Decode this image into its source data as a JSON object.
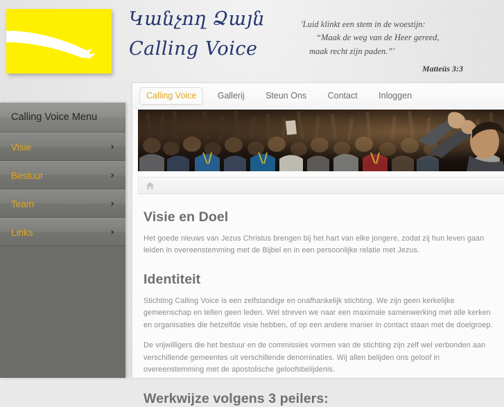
{
  "header": {
    "logo_alt": "Calling Voice logo",
    "brand_armenian": "Կանչող Ձայն",
    "brand_english": "Calling Voice",
    "verse_line1": "'Luid klinkt een stem in de woestijn:",
    "verse_line2": "“Maak de weg van de Heer gereed,",
    "verse_line3": "maak recht zijn paden.”'",
    "verse_ref": "Matteüs 3:3"
  },
  "sidebar": {
    "title": "Calling Voice Menu",
    "items": [
      {
        "label": "Visie",
        "chevron": "›"
      },
      {
        "label": "Bestuur",
        "chevron": "›"
      },
      {
        "label": "Team",
        "chevron": "›"
      },
      {
        "label": "Links",
        "chevron": "›"
      }
    ]
  },
  "nav": {
    "tabs": [
      {
        "label": "Calling Voice",
        "active": true
      },
      {
        "label": "Gallerij",
        "active": false
      },
      {
        "label": "Steun Ons",
        "active": false
      },
      {
        "label": "Contact",
        "active": false
      },
      {
        "label": "Inloggen",
        "active": false
      }
    ]
  },
  "breadcrumb": {
    "home_icon": "home-icon"
  },
  "main": {
    "heading1": "Visie en Doel",
    "paragraph1": "Het goede nieuws van Jezus Christus brengen bij het hart van elke jongere, zodat zij hun leven gaan leiden in overeenstemming met de Bijbel en in een persoonlijke relatie met Jezus.",
    "heading2": "Identiteit",
    "paragraph2": "Stichting Calling Voice is een zelfstandige en onafhankelijk stichting. We zijn geen kerkelijke gemeenschap en tellen geen leden. Wel streven we naar een maximale samenwerking met alle kerken en organisaties die hetzelfde visie hebben, of op een andere manier in contact staan met de doelgroep.",
    "paragraph3": "De vrijwilligers die het bestuur en de commissies vormen van de stichting zijn zelf wel verbonden aan verschillende gemeentes uit verschillende denominaties. Wij allen belijden ons geloof in overeenstemming met de apostolische geloofsbelijdenis.",
    "heading3": "Werkwijze volgens 3 peilers:"
  },
  "colors": {
    "logo_yellow": "#ffef00",
    "brand_navy": "#24356e",
    "menu_gold": "#e5a81d",
    "sidebar_gray": "#6c6c68",
    "body_gray": "#8b8b8b",
    "heading_gray": "#6e6e6e"
  }
}
